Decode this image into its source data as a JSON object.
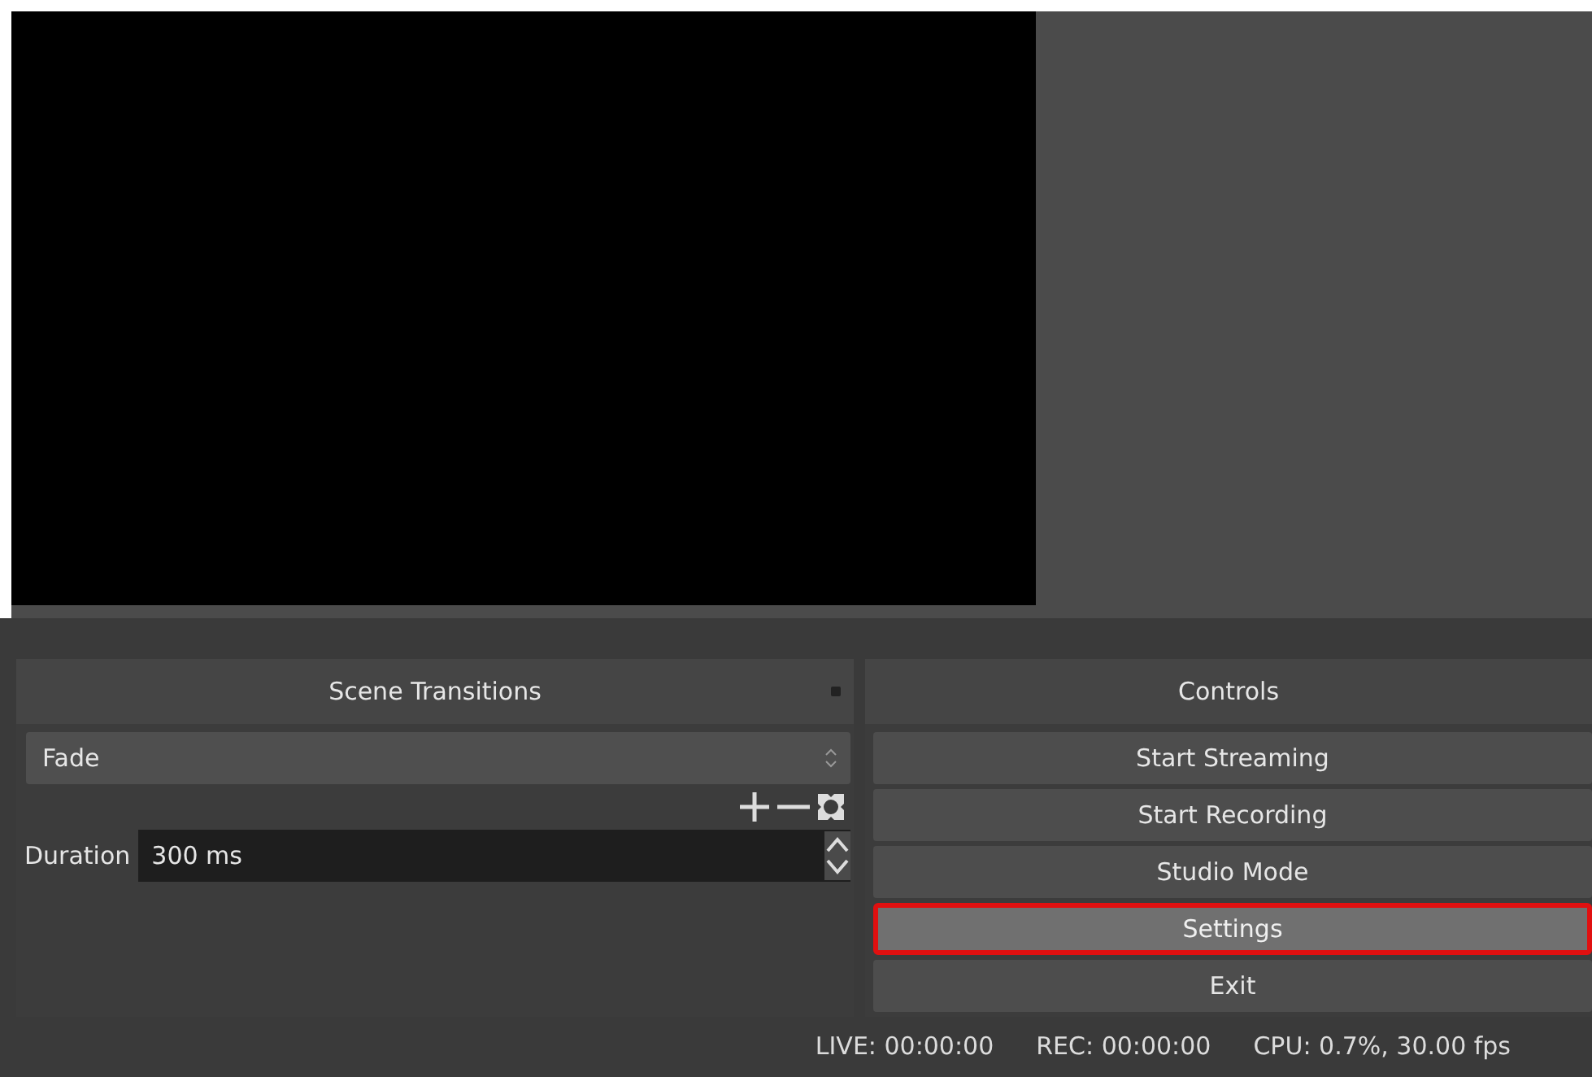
{
  "scene_transitions": {
    "title": "Scene Transitions",
    "transition": "Fade",
    "duration_label": "Duration",
    "duration": "300 ms"
  },
  "controls": {
    "title": "Controls",
    "buttons": [
      {
        "label": "Start Streaming",
        "selected": false
      },
      {
        "label": "Start Recording",
        "selected": false
      },
      {
        "label": "Studio Mode",
        "selected": false
      },
      {
        "label": "Settings",
        "selected": true
      },
      {
        "label": "Exit",
        "selected": false
      }
    ]
  },
  "status_bar": {
    "live": "LIVE: 00:00:00",
    "rec": "REC: 00:00:00",
    "cpu": "CPU: 0.7%, 30.00 fps"
  }
}
